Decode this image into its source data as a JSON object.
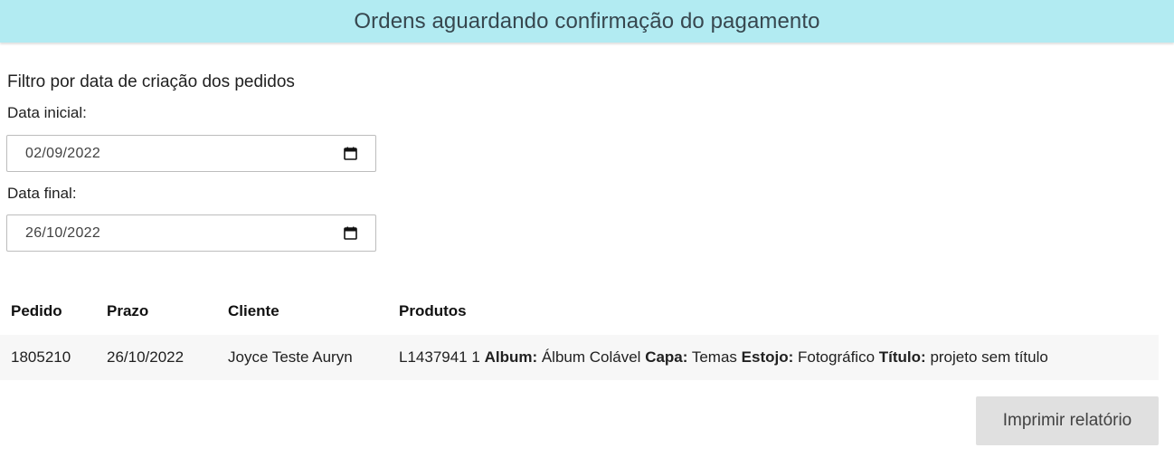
{
  "header": {
    "title": "Ordens aguardando confirmação do pagamento"
  },
  "filter": {
    "title": "Filtro por data de criação dos pedidos",
    "start_label": "Data inicial:",
    "start_value": "02/09/2022",
    "end_label": "Data final:",
    "end_value": "26/10/2022",
    "icon": "calendar-icon"
  },
  "table": {
    "headers": {
      "pedido": "Pedido",
      "prazo": "Prazo",
      "cliente": "Cliente",
      "produtos": "Produtos"
    },
    "rows": [
      {
        "pedido": "1805210",
        "prazo": "26/10/2022",
        "cliente": "Joyce Teste Auryn",
        "produtos": {
          "code": "L1437941 1",
          "album_label": "Album:",
          "album_value": "Álbum Colável",
          "capa_label": "Capa:",
          "capa_value": "Temas",
          "estojo_label": "Estojo:",
          "estojo_value": "Fotográfico",
          "titulo_label": "Título:",
          "titulo_value": "projeto sem título"
        }
      }
    ]
  },
  "actions": {
    "print_label": "Imprimir relatório"
  },
  "colors": {
    "header_bg": "#b2ebf2",
    "button_bg": "#e0e0e0",
    "row_bg": "#f7f7f7"
  }
}
